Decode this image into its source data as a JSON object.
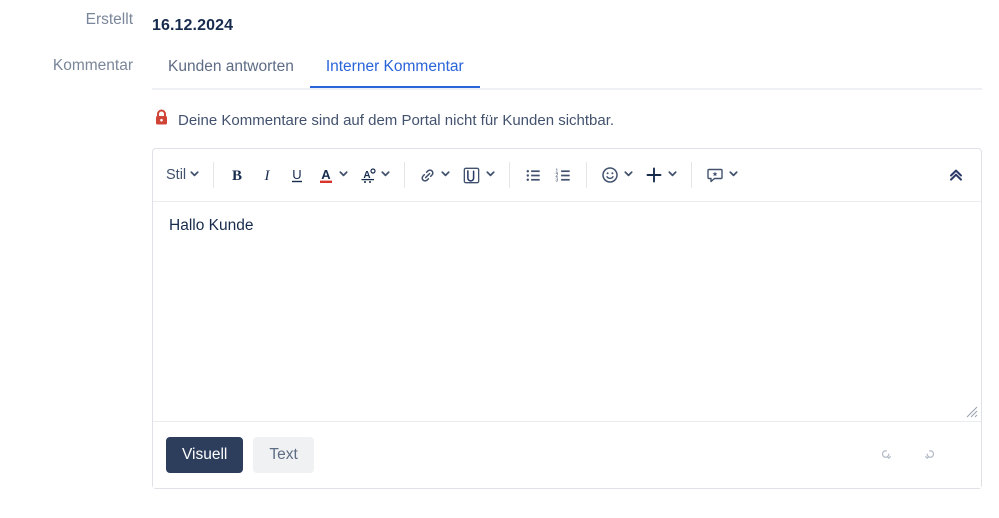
{
  "fields": {
    "created_label": "Erstellt",
    "created_value": "16.12.2024",
    "comment_label": "Kommentar"
  },
  "tabs": [
    {
      "label": "Kunden antworten",
      "active": false
    },
    {
      "label": "Interner Kommentar",
      "active": true
    }
  ],
  "notice": {
    "icon": "lock-icon",
    "text": "Deine Kommentare sind auf dem Portal nicht für Kunden sichtbar.",
    "icon_color": "#d04437"
  },
  "toolbar": {
    "style_label": "Stil",
    "buttons": [
      {
        "name": "style-dropdown",
        "icon": "text-style-icon",
        "label": "Stil",
        "has_caret": true
      },
      {
        "name": "bold-button",
        "icon": "bold-icon",
        "label": "B",
        "has_caret": false
      },
      {
        "name": "italic-button",
        "icon": "italic-icon",
        "label": "I",
        "has_caret": false
      },
      {
        "name": "underline-button",
        "icon": "underline-icon",
        "label": "U",
        "has_caret": false
      },
      {
        "name": "text-color-button",
        "icon": "text-color-icon",
        "label": "A",
        "has_caret": true
      },
      {
        "name": "highlight-color-button",
        "icon": "highlight-color-icon",
        "label": "",
        "has_caret": true
      },
      {
        "name": "link-button",
        "icon": "link-icon",
        "label": "",
        "has_caret": true
      },
      {
        "name": "attachment-button",
        "icon": "attachment-icon",
        "label": "",
        "has_caret": true
      },
      {
        "name": "bullet-list-button",
        "icon": "bullet-list-icon",
        "label": "",
        "has_caret": false
      },
      {
        "name": "numbered-list-button",
        "icon": "numbered-list-icon",
        "label": "",
        "has_caret": false
      },
      {
        "name": "emoji-button",
        "icon": "emoji-icon",
        "label": "",
        "has_caret": true
      },
      {
        "name": "insert-button",
        "icon": "plus-icon",
        "label": "",
        "has_caret": true
      },
      {
        "name": "quote-button",
        "icon": "speech-bubble-icon",
        "label": "",
        "has_caret": true
      },
      {
        "name": "collapse-toolbar-button",
        "icon": "chevron-double-up-icon",
        "label": "",
        "has_caret": false
      }
    ]
  },
  "editor": {
    "body_text": "Hallo Kunde",
    "resize_handle": "resize-grip-icon"
  },
  "footer": {
    "visual_label": "Visuell",
    "text_label": "Text",
    "undo_icon": "undo-icon",
    "redo_icon": "redo-icon"
  },
  "colors": {
    "accent": "#2a64d9",
    "primary_button": "#2d3e5c",
    "text_dark": "#172b4d",
    "text_muted": "#5e6c84",
    "label": "#7a8699",
    "border": "#dfe1e6",
    "red": "#d04437"
  }
}
